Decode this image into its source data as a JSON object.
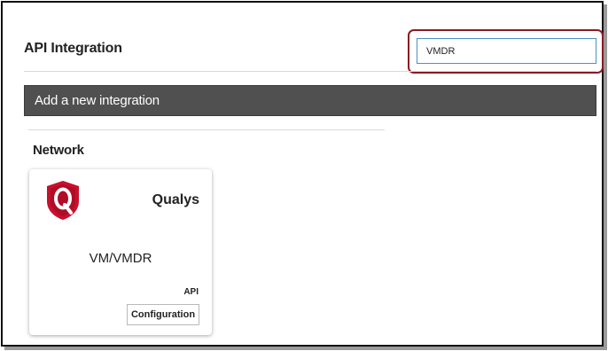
{
  "page": {
    "title": "API Integration"
  },
  "search": {
    "value": "VMDR"
  },
  "banner": {
    "label": "Add a new integration"
  },
  "section": {
    "title": "Network",
    "cards": [
      {
        "vendor": "Qualys",
        "product": "VM/VMDR",
        "type": "API",
        "button_label": "Configuration",
        "logo_icon": "qualys-shield-icon",
        "logo_color": "#c8102e"
      }
    ]
  }
}
